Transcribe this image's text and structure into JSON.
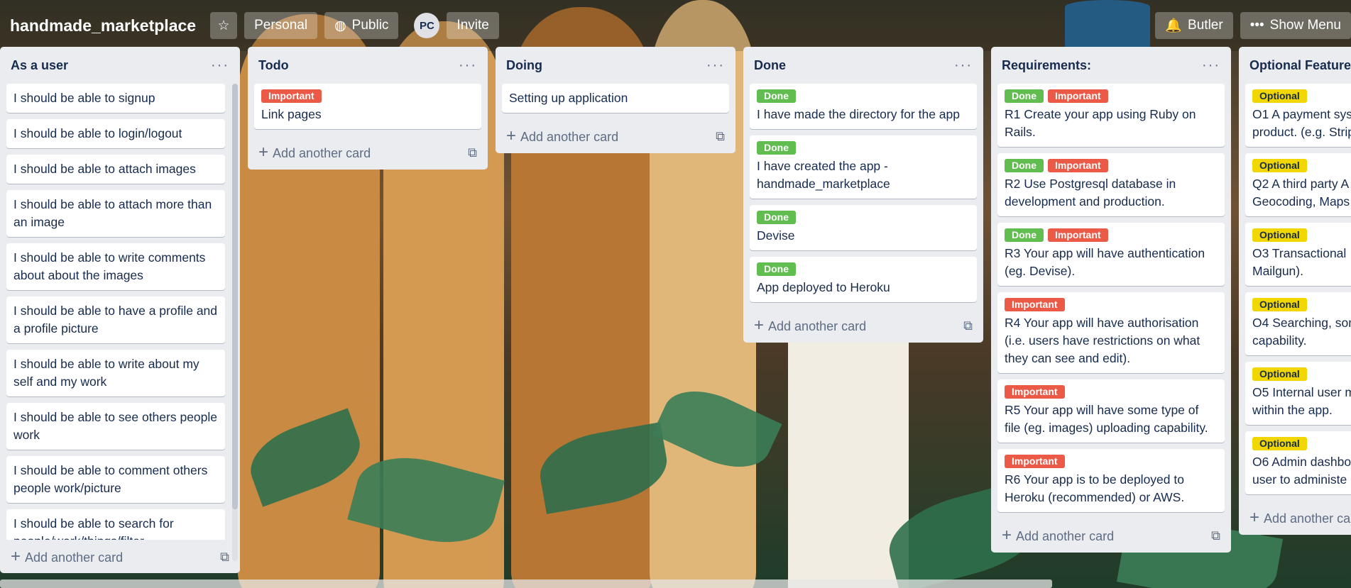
{
  "header": {
    "title": "handmade_marketplace",
    "personal": "Personal",
    "public": "Public",
    "avatar": "PC",
    "invite": "Invite",
    "butler": "Butler",
    "show_menu": "Show Menu"
  },
  "colors": {
    "done": "#61bd4f",
    "important": "#eb5a46",
    "optional": "#f2d600"
  },
  "add_card_label": "Add another card",
  "lists": [
    {
      "title": "As a user",
      "cards": [
        {
          "text": "I should be able to signup"
        },
        {
          "text": "I should be able to login/logout"
        },
        {
          "text": "I should be able to attach images"
        },
        {
          "text": "I should be able to attach more than an image"
        },
        {
          "text": "I should be able to write comments about about the images"
        },
        {
          "text": "I should be able to have a profile and a profile picture"
        },
        {
          "text": "I should be able to write about my self and my work"
        },
        {
          "text": "I should be able to see others people work"
        },
        {
          "text": "I should be able to comment others people work/picture"
        },
        {
          "text": "I should be able to search for people/work/things/filter"
        }
      ]
    },
    {
      "title": "Todo",
      "cards": [
        {
          "labels": [
            "Important"
          ],
          "text": "Link pages"
        }
      ]
    },
    {
      "title": "Doing",
      "cards": [
        {
          "text": "Setting up application"
        }
      ]
    },
    {
      "title": "Done",
      "cards": [
        {
          "labels": [
            "Done"
          ],
          "text": "I have made the directory for the app"
        },
        {
          "labels": [
            "Done"
          ],
          "text": "I have created the app - handmade_marketplace"
        },
        {
          "labels": [
            "Done"
          ],
          "text": "Devise"
        },
        {
          "labels": [
            "Done"
          ],
          "text": "App deployed to Heroku"
        }
      ]
    },
    {
      "title": "Requirements:",
      "cards": [
        {
          "labels": [
            "Done",
            "Important"
          ],
          "text": "R1 Create your app using Ruby on Rails."
        },
        {
          "labels": [
            "Done",
            "Important"
          ],
          "text": "R2 Use Postgresql database in development and production."
        },
        {
          "labels": [
            "Done",
            "Important"
          ],
          "text": "R3 Your app will have authentication (eg. Devise)."
        },
        {
          "labels": [
            "Important"
          ],
          "text": "R4 Your app will have authorisation (i.e. users have restrictions on what they can see and edit)."
        },
        {
          "labels": [
            "Important"
          ],
          "text": "R5 Your app will have some type of file (eg. images) uploading capability."
        },
        {
          "labels": [
            "Important"
          ],
          "text": "R6 Your app is to be deployed to Heroku (recommended) or AWS."
        }
      ]
    },
    {
      "title": "Optional Feature",
      "cards": [
        {
          "labels": [
            "Optional"
          ],
          "text": "O1 A payment sys product. (e.g. Strip"
        },
        {
          "labels": [
            "Optional"
          ],
          "text": "Q2 A third party A Geocoding, Maps"
        },
        {
          "labels": [
            "Optional"
          ],
          "text": "O3 Transactional Mailgun)."
        },
        {
          "labels": [
            "Optional"
          ],
          "text": "O4 Searching, sor capability."
        },
        {
          "labels": [
            "Optional"
          ],
          "text": "O5 Internal user m within the app."
        },
        {
          "labels": [
            "Optional"
          ],
          "text": "O6 Admin dashbo user to administe"
        }
      ]
    }
  ]
}
